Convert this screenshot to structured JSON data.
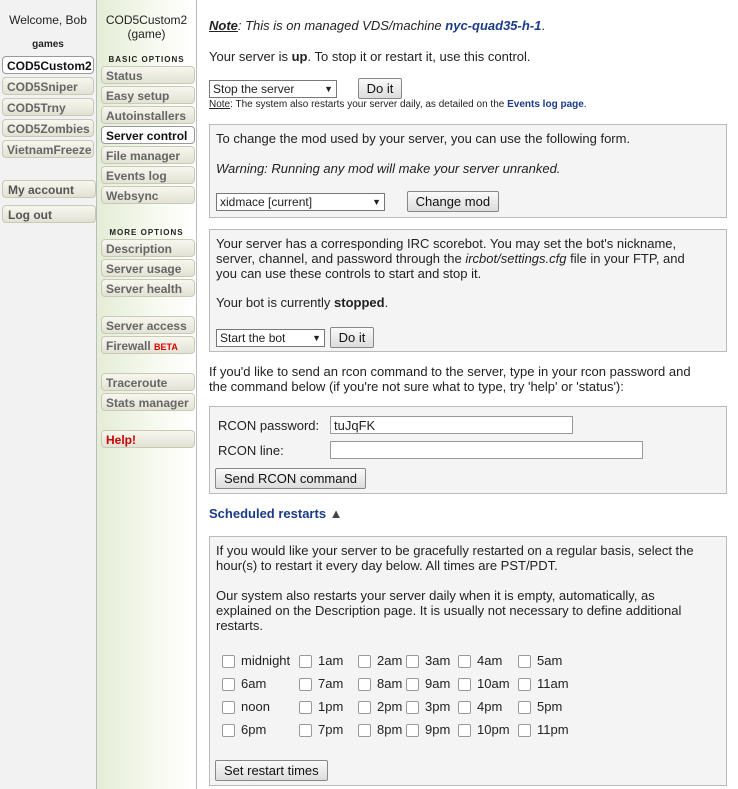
{
  "col1": {
    "welcome": "Welcome, Bob",
    "games_heading": "games",
    "games": [
      "COD5Custom2",
      "COD5Sniper",
      "COD5Trny",
      "COD5Zombies",
      "VietnamFreeze"
    ],
    "account": "My account",
    "logout": "Log out"
  },
  "col2": {
    "game_name": "COD5Custom2",
    "game_type": "(game)",
    "basic_heading": "BASIC OPTIONS",
    "basic": [
      "Status",
      "Easy setup",
      "Autoinstallers",
      "Server control",
      "File manager",
      "Events log",
      "Websync"
    ],
    "more_heading": "MORE OPTIONS",
    "more1": [
      "Description",
      "Server usage",
      "Server health"
    ],
    "more2_access": "Server access",
    "more2_firewall": "Firewall",
    "beta": "BETA",
    "more3": [
      "Traceroute",
      "Stats manager"
    ],
    "help": "Help!"
  },
  "main": {
    "note_label": "Note",
    "note_text": ": This is on managed VDS/machine ",
    "machine": "nyc-quad35-h-1",
    "note_end": ".",
    "status_pre": "Your server is ",
    "status_val": "up",
    "status_post": ". To stop it or restart it, use this control.",
    "server_select": "Stop the server",
    "do_it": "Do it",
    "small_note_label": "Note",
    "small_note_text": ": The system also restarts your server daily, as detailed on the ",
    "events_link": "Events log page",
    "small_note_end": ".",
    "mod_text": "To change the mod used by your server, you can use the following form.",
    "mod_warning": "Warning: Running any mod will make your server unranked.",
    "mod_select": "xidmace [current]",
    "change_mod": "Change mod",
    "irc_text_1": "Your server has a corresponding IRC scorebot. You may set the bot's nickname,",
    "irc_text_2": "server, channel, and password through the ",
    "irc_file": "ircbot/settings.cfg",
    "irc_text_3": " file in your FTP, and",
    "irc_text_4": "you can use these controls to start and stop it.",
    "bot_pre": "Your bot is currently ",
    "bot_status": "stopped",
    "bot_post": ".",
    "bot_select": "Start the bot",
    "bot_do_it": "Do it",
    "rcon_intro_1": "If you'd like to send an rcon command to the server, type in your rcon password and",
    "rcon_intro_2": "the command below (if you're not sure what to type, try 'help' or 'status'):",
    "rcon_password_label": "RCON password:",
    "rcon_password_value": "tuJqFK",
    "rcon_line_label": "RCON line:",
    "rcon_line_value": "",
    "send_rcon": "Send RCON command",
    "sched_title": "Scheduled restarts",
    "sched_arrow": "▲",
    "sched_text_1": "If you would like your server to be gracefully restarted on a regular basis, select the",
    "sched_text_2": "hour(s) to restart it every day below. All times are PST/PDT.",
    "sched_text_3": "Our system also restarts your server daily when it is empty, automatically, as",
    "sched_text_4": "explained on the Description page. It is usually not necessary to define additional",
    "sched_text_5": "restarts.",
    "hours": [
      "midnight",
      "1am",
      "2am",
      "3am",
      "4am",
      "5am",
      "6am",
      "7am",
      "8am",
      "9am",
      "10am",
      "11am",
      "noon",
      "1pm",
      "2pm",
      "3pm",
      "4pm",
      "5pm",
      "6pm",
      "7pm",
      "8pm",
      "9pm",
      "10pm",
      "11pm"
    ],
    "set_restart": "Set restart times"
  }
}
